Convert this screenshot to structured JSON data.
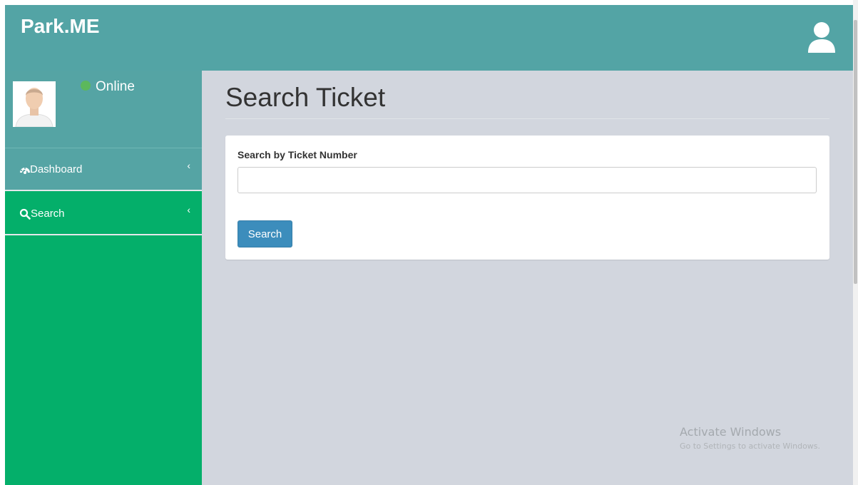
{
  "header": {
    "brand": "Park.ME",
    "user_icon": "user-icon"
  },
  "sidebar": {
    "status_text": "Online",
    "status_color": "#5cb85c",
    "items": [
      {
        "label": "Dashboard",
        "icon": "dashboard-icon",
        "chevron": "‹"
      },
      {
        "label": "Search",
        "icon": "search-icon",
        "chevron": "‹"
      }
    ]
  },
  "main": {
    "title": "Search Ticket",
    "form": {
      "label": "Search by Ticket Number",
      "value": "",
      "button_label": "Search"
    }
  },
  "watermark": {
    "title": "Activate Windows",
    "subtitle": "Go to Settings to activate Windows."
  },
  "colors": {
    "header": "#53a4a5",
    "sidebar_active": "#04af6a",
    "button": "#3c8dbc",
    "content_bg": "#d2d6de"
  }
}
